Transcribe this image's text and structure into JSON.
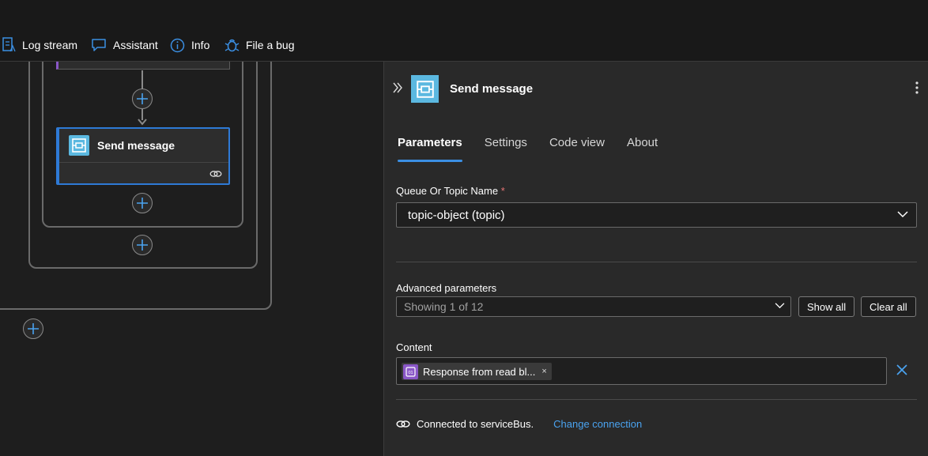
{
  "toolbar": {
    "items": [
      {
        "label": "Log stream",
        "icon": "log-stream-icon"
      },
      {
        "label": "Assistant",
        "icon": "chat-icon"
      },
      {
        "label": "Info",
        "icon": "info-icon"
      },
      {
        "label": "File a bug",
        "icon": "bug-icon"
      }
    ]
  },
  "canvas": {
    "action_card": {
      "title": "Send message",
      "icon": "service-bus-icon"
    }
  },
  "panel": {
    "title": "Send message",
    "tabs": [
      {
        "label": "Parameters",
        "active": true
      },
      {
        "label": "Settings",
        "active": false
      },
      {
        "label": "Code view",
        "active": false
      },
      {
        "label": "About",
        "active": false
      }
    ],
    "queue_label": "Queue Or Topic Name",
    "queue_required": "*",
    "queue_value": "topic-object (topic)",
    "advanced_label": "Advanced parameters",
    "advanced_value": "Showing 1 of 12",
    "show_all": "Show all",
    "clear_all": "Clear all",
    "content_label": "Content",
    "content_token": "Response from read bl...",
    "token_close": "×",
    "connected_text": "Connected to serviceBus.",
    "change_connection": "Change connection"
  },
  "colors": {
    "accent": "#3b8fe3",
    "service_bus": "#5bb8e0",
    "blob_token": "#8a57c7",
    "link": "#4aa3f0"
  }
}
